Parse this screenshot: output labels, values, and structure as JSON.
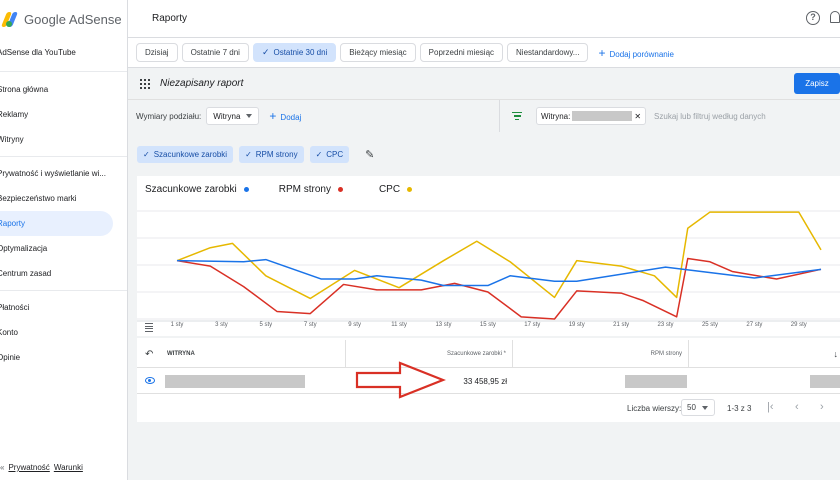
{
  "app": {
    "brand": "Google AdSense",
    "product": "AdSense dla YouTube"
  },
  "sidebar": {
    "items": [
      {
        "label": "Strona główna"
      },
      {
        "label": "Reklamy"
      },
      {
        "label": "Witryny"
      },
      {
        "label": "Prywatność i wyświetlanie wi..."
      },
      {
        "label": "Bezpieczeństwo marki"
      },
      {
        "label": "Raporty"
      },
      {
        "label": "Optymalizacja"
      },
      {
        "label": "Centrum zasad"
      },
      {
        "label": "Płatności"
      },
      {
        "label": "Konto"
      },
      {
        "label": "Opinie"
      }
    ],
    "footer": {
      "prefix": "«",
      "privacy": "Prywatność",
      "terms": "Warunki"
    }
  },
  "topbar": {
    "title": "Raporty",
    "help_icon": "help-icon",
    "bell_icon": "notifications-icon"
  },
  "date_chips": [
    {
      "label": "Dzisiaj"
    },
    {
      "label": "Ostatnie 7 dni"
    },
    {
      "label": "Ostatnie 30 dni",
      "selected": true
    },
    {
      "label": "Bieżący miesiąc"
    },
    {
      "label": "Poprzedni miesiąc"
    },
    {
      "label": "Niestandardowy..."
    }
  ],
  "add_comparison": "Dodaj porównanie",
  "report": {
    "name": "Niezapisany raport",
    "save": "Zapisz"
  },
  "dimensions": {
    "label": "Wymiary podziału:",
    "selected": "Witryna",
    "add": "Dodaj"
  },
  "filter": {
    "label": "Witryna:",
    "search_placeholder": "Szukaj lub filtruj według danych"
  },
  "metrics": [
    {
      "label": "Szacunkowe zarobki"
    },
    {
      "label": "RPM strony"
    },
    {
      "label": "CPC"
    }
  ],
  "chart_data": {
    "type": "line",
    "x": [
      "1 sty",
      "2 sty",
      "3 sty",
      "4 sty",
      "5 sty",
      "6 sty",
      "7 sty",
      "8 sty",
      "9 sty",
      "10 sty",
      "11 sty",
      "12 sty",
      "13 sty",
      "14 sty",
      "15 sty",
      "16 sty",
      "17 sty",
      "18 sty",
      "19 sty",
      "20 sty",
      "21 sty",
      "22 sty",
      "23 sty",
      "24 sty",
      "25 sty",
      "26 sty",
      "27 sty",
      "28 sty",
      "29 sty",
      "30 sty"
    ],
    "tick_labels": [
      "1 sty",
      "3 sty",
      "5 sty",
      "7 sty",
      "9 sty",
      "11 sty",
      "13 sty",
      "15 sty",
      "17 sty",
      "19 sty",
      "21 sty",
      "23 sty",
      "25 sty",
      "27 sty",
      "29 sty"
    ],
    "series": [
      {
        "name": "Szacunkowe zarobki",
        "color": "#1a73e8",
        "values": [
          5.4,
          5.3,
          5.5,
          3.7,
          3.7,
          4.0,
          3.6,
          3.1,
          3.1,
          4.0,
          3.5,
          3.5,
          4.8,
          3.8,
          4.6
        ]
      },
      {
        "name": "RPM strony",
        "color": "#d93025",
        "values": [
          5.4,
          4.9,
          3.0,
          0.7,
          0.5,
          3.2,
          2.7,
          2.7,
          3.3,
          2.5,
          0.2,
          0.0,
          2.6,
          2.4,
          1.7,
          0.2,
          5.6,
          5.3,
          4.4,
          3.7,
          4.6
        ]
      },
      {
        "name": "CPC",
        "color": "#e6b800",
        "values": [
          5.4,
          6.6,
          7.0,
          4.0,
          1.9,
          4.5,
          2.9,
          5.4,
          7.2,
          5.3,
          2.0,
          5.4,
          4.9,
          4.0,
          2.0,
          8.4,
          9.9,
          9.9,
          9.9,
          6.4
        ]
      }
    ],
    "x_points_cpc": [
      "1 sty",
      "2.5 sty",
      "3.5 sty",
      "5 sty",
      "7 sty",
      "9 sty",
      "11 sty",
      "13 sty",
      "14.5 sty",
      "16 sty",
      "18 sty",
      "19 sty",
      "21 sty",
      "22.5 sty",
      "23.5 sty",
      "24 sty",
      "25 sty",
      "27 sty",
      "29 sty",
      "30 sty"
    ],
    "grid": true,
    "legend": "top-left"
  },
  "table": {
    "columns": [
      "WITRYNA",
      "Szacunkowe zarobki",
      "RPM strony"
    ],
    "row": {
      "earnings": "33 458,95 zł"
    },
    "rows_per_page_label": "Liczba wierszy:",
    "rows_per_page": "50",
    "range": "1-3 z 3"
  },
  "annotation": {
    "color": "#d93025",
    "shape": "arrow"
  }
}
